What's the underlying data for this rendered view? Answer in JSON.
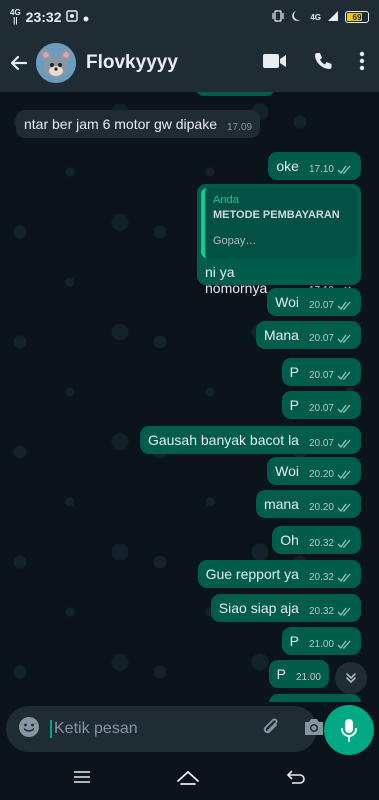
{
  "status": {
    "network_top": "4G",
    "network_bottom": "||",
    "time": "23:32",
    "network2": "4G",
    "battery": "69"
  },
  "header": {
    "contact_name": "Flovkyyyy"
  },
  "messages": [
    {
      "dir": "in",
      "text": "ntar ber jam 6 motor gw dipake",
      "time": "17.09"
    },
    {
      "dir": "out",
      "text": "oke",
      "time": "17.10"
    },
    {
      "dir": "out",
      "text": "ni ya nomornya",
      "time": "17.10",
      "quote": {
        "sender": "Anda",
        "title": "METODE PEMBAYARAN",
        "snippet": "Gopay…"
      }
    },
    {
      "dir": "out",
      "text": "Woi",
      "time": "20.07"
    },
    {
      "dir": "out",
      "text": "Mana",
      "time": "20.07"
    },
    {
      "dir": "out",
      "text": "P",
      "time": "20.07"
    },
    {
      "dir": "out",
      "text": "P",
      "time": "20.07"
    },
    {
      "dir": "out",
      "text": "Gausah banyak bacot la",
      "time": "20.07"
    },
    {
      "dir": "out",
      "text": "Woi",
      "time": "20.20"
    },
    {
      "dir": "out",
      "text": "mana",
      "time": "20.20"
    },
    {
      "dir": "out",
      "text": "Oh",
      "time": "20.32"
    },
    {
      "dir": "out",
      "text": "Gue repport ya",
      "time": "20.32"
    },
    {
      "dir": "out",
      "text": "Siao siap aja",
      "time": "20.32"
    },
    {
      "dir": "out",
      "text": "P",
      "time": "21.00"
    },
    {
      "dir": "out",
      "text": "P",
      "time": "21.00"
    }
  ],
  "composer": {
    "placeholder": "Ketik pesan"
  },
  "colors": {
    "outgoing": "#005c4b",
    "incoming": "#202c33",
    "accent": "#00a884"
  }
}
